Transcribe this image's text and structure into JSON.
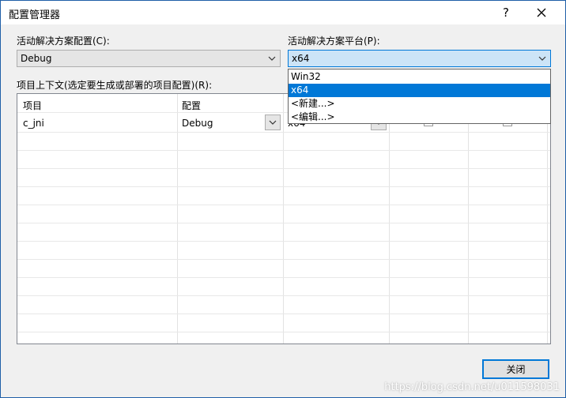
{
  "window": {
    "title": "配置管理器",
    "help_label": "?",
    "close_label": "✕"
  },
  "active_config": {
    "label": "活动解决方案配置(C):",
    "value": "Debug"
  },
  "active_platform": {
    "label": "活动解决方案平台(P):",
    "value": "x64",
    "options": [
      "Win32",
      "x64",
      "<新建...>",
      "<编辑...>"
    ],
    "selected_index": 1
  },
  "project_context": {
    "label": "项目上下文(选定要生成或部署的项目配置)(R):",
    "columns": [
      "项目",
      "配置"
    ],
    "rows": [
      {
        "project": "c_jni",
        "config": "Debug",
        "platform": "x64",
        "build": "✓",
        "deploy": ""
      }
    ]
  },
  "buttons": {
    "close": "关闭"
  },
  "watermark": "https://blog.csdn.net/u011598031"
}
